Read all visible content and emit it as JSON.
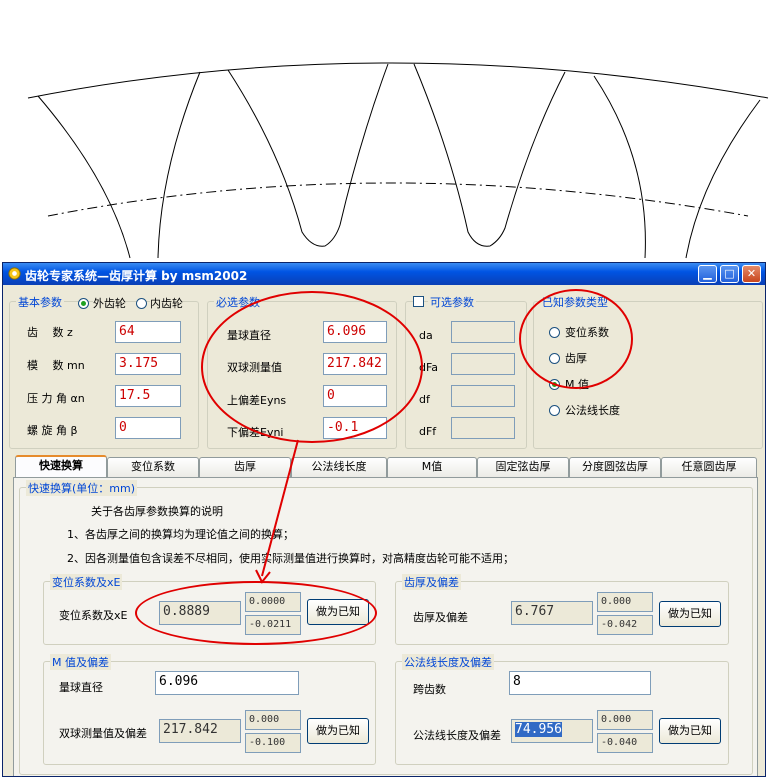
{
  "window": {
    "title": "齿轮专家系统—齿厚计算 by msm2002"
  },
  "basic": {
    "legend": "基本参数",
    "gear_type_options": [
      "外齿轮",
      "内齿轮"
    ],
    "z_label": "齿　 数 z",
    "z": "64",
    "mn_label": "模　 数 mn",
    "mn": "3.175",
    "alpha_label": "压 力 角 αn",
    "alpha": "17.5",
    "beta_label": "螺 旋 角 β",
    "beta": "0"
  },
  "required": {
    "legend": "必选参数",
    "ball_label": "量球直径",
    "ball": "6.096",
    "m_label": "双球测量值",
    "m": "217.842",
    "upper_label": "上偏差Eyns",
    "upper": "0",
    "lower_label": "下偏差Eyni",
    "lower": "-0.1"
  },
  "optional": {
    "legend": "可选参数",
    "da_label": "da",
    "dfa_label": "dFa",
    "df_label": "df",
    "dff_label": "dFf"
  },
  "known": {
    "legend": "已知参数类型",
    "options": [
      "变位系数",
      "齿厚",
      "M 值",
      "公法线长度"
    ],
    "selected": "M 值"
  },
  "tabs": [
    "快速换算",
    "变位系数",
    "齿厚",
    "公法线长度",
    "M值",
    "固定弦齿厚",
    "分度圆弦齿厚",
    "任意圆齿厚"
  ],
  "quick": {
    "legend": "快速换算(单位：mm)",
    "note_title": "关于各齿厚参数换算的说明",
    "note1": "1、各齿厚之间的换算均为理论值之间的换算；",
    "note2": "2、因各测量值包含误差不尽相同，使用实际测量值进行换算时，对高精度齿轮可能不适用；",
    "shift": {
      "legend": "变位系数及xE",
      "label": "变位系数及xE",
      "value": "0.8889",
      "upper": "0.0000",
      "lower": "-0.0211",
      "button": "做为已知"
    },
    "thick": {
      "legend": "齿厚及偏差",
      "label": "齿厚及偏差",
      "value": "6.767",
      "upper": "0.000",
      "lower": "-0.042",
      "button": "做为已知"
    },
    "mval": {
      "legend": "M 值及偏差",
      "ball_label": "量球直径",
      "ball": "6.096",
      "label": "双球测量值及偏差",
      "value": "217.842",
      "upper": "0.000",
      "lower": "-0.100",
      "button": "做为已知"
    },
    "wk": {
      "legend": "公法线长度及偏差",
      "span_label": "跨齿数",
      "span": "8",
      "label": "公法线长度及偏差",
      "value": "74.956",
      "upper": "0.000",
      "lower": "-0.040",
      "button": "做为已知"
    }
  },
  "colors": {
    "title_bar": "#0054e3",
    "annotation": "#e00000",
    "input_red_text": "#cc0000",
    "legend_text": "#0046d5"
  }
}
